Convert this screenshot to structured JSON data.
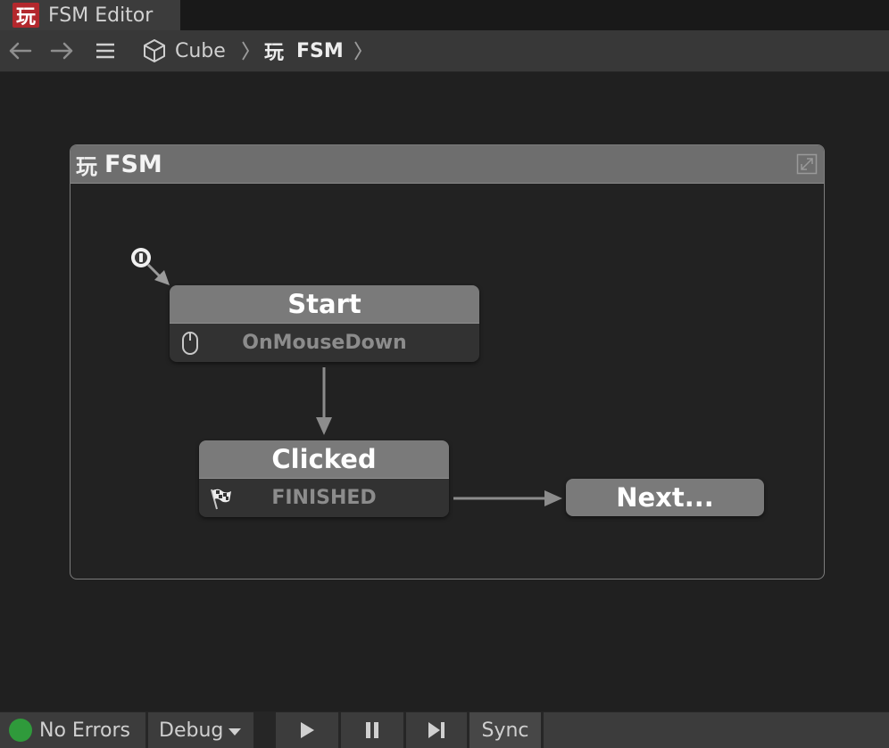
{
  "tab": {
    "logo": "玩",
    "title": "FSM Editor"
  },
  "toolbar": {
    "breadcrumb": [
      {
        "label": "Cube"
      },
      {
        "logo": "玩",
        "label": "FSM"
      }
    ]
  },
  "group": {
    "logo": "玩",
    "title": "FSM"
  },
  "states": {
    "start": {
      "title": "Start",
      "event": "OnMouseDown"
    },
    "clicked": {
      "title": "Clicked",
      "event": "FINISHED"
    },
    "next": {
      "title": "Next..."
    }
  },
  "statusbar": {
    "status": "No Errors",
    "status_color": "#2f9a3b",
    "debug": "Debug",
    "sync": "Sync"
  }
}
